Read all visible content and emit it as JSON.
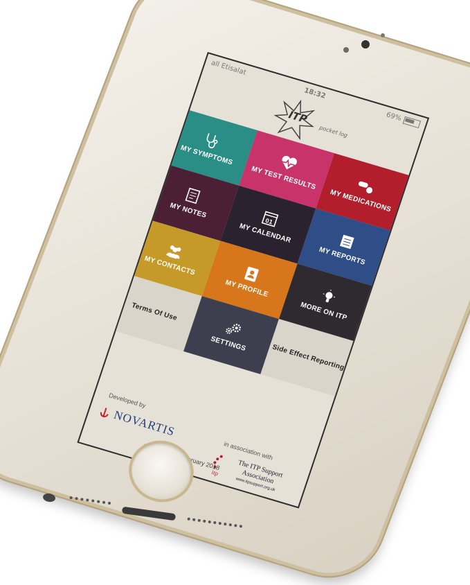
{
  "status_bar": {
    "carrier": "all Etisalat",
    "time": "18:32",
    "battery": "69%"
  },
  "logo": {
    "title": "ITP",
    "subtitle": "pocket log"
  },
  "tiles": [
    {
      "label": "MY SYMPTOMS",
      "icon": "stethoscope-icon"
    },
    {
      "label": "MY TEST RESULTS",
      "icon": "heart-pulse-icon"
    },
    {
      "label": "MY MEDICATIONS",
      "icon": "pills-icon"
    },
    {
      "label": "MY NOTES",
      "icon": "notepad-icon"
    },
    {
      "label": "MY CALENDAR",
      "icon": "calendar-icon",
      "day": "01"
    },
    {
      "label": "MY REPORTS",
      "icon": "report-icon"
    },
    {
      "label": "MY CONTACTS",
      "icon": "people-icon"
    },
    {
      "label": "MY PROFILE",
      "icon": "profile-book-icon"
    },
    {
      "label": "MORE ON ITP",
      "icon": "lightbulb-icon"
    },
    {
      "label": "Terms Of Use",
      "icon": ""
    },
    {
      "label": "SETTINGS",
      "icon": "gears-icon"
    },
    {
      "label": "Side Effect Reporting",
      "icon": ""
    }
  ],
  "footer": {
    "developed_by": "Developed by",
    "novartis": "NOVARTIS",
    "in_association": "in association with",
    "code": "ONC17-C114 February 2018",
    "itp_small": "itp",
    "support_line1": "The ITP Support",
    "support_line2": "Association",
    "support_url": "www.itpsupport.org.uk"
  },
  "colors": {
    "symptoms": "#2a8d86",
    "test_results": "#c8346a",
    "medications": "#b21e2c",
    "notes": "#4b2034",
    "calendar": "#2b2230",
    "reports": "#2f4d87",
    "contacts": "#c69a28",
    "profile": "#d8761c",
    "more_on_itp": "#2e2a30",
    "settings": "#3d3f4f",
    "novartis_blue": "#1f3f7a"
  }
}
